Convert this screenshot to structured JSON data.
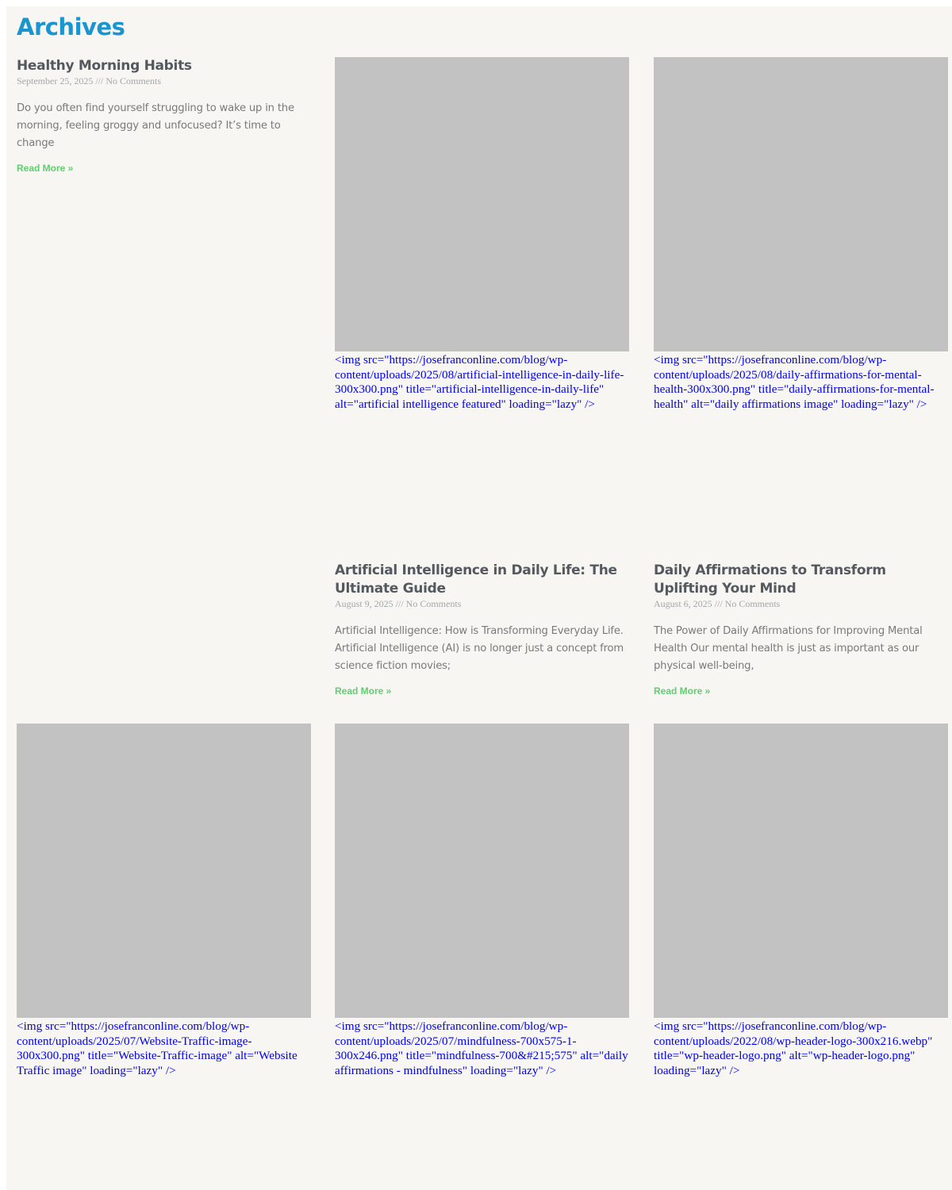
{
  "page": {
    "title": "Archives"
  },
  "colors": {
    "title": "#1a95cf",
    "read_more": "#61ce70",
    "post_title": "#54595f",
    "meta": "#a3a6aa",
    "thumbnail_placeholder": "#c2c2c2",
    "background": "#f7f6f3",
    "img_fallback_text": "#0000ee"
  },
  "posts": [
    {
      "title": "Healthy Morning Habits",
      "meta": "September 25, 2025 /// No Comments",
      "excerpt": "Do you often find yourself struggling to wake up in the morning, feeling groggy and unfocused? It’s time to change",
      "read_more": "Read More »"
    },
    {
      "img_text": "<img src=\"https://josefranconline.com/blog/wp-content/uploads/2025/08/artificial-intelligence-in-daily-life-300x300.png\" title=\"artificial-intelligence-in-daily-life\" alt=\"artificial intelligence featured\" loading=\"lazy\" />",
      "title": "Artificial Intelligence in Daily Life: The Ultimate Guide",
      "meta": "August 9, 2025 /// No Comments",
      "excerpt": "Artificial Intelligence: How is Transforming Everyday Life. Artificial Intelligence (AI) is no longer just a concept from science fiction movies;",
      "read_more": "Read More »"
    },
    {
      "img_text": "<img src=\"https://josefranconline.com/blog/wp-content/uploads/2025/08/daily-affirmations-for-mental-health-300x300.png\" title=\"daily-affirmations-for-mental-health\" alt=\"daily affirmations image\" loading=\"lazy\" />",
      "title": "Daily Affirmations to Transform Uplifting Your Mind",
      "meta": "August 6, 2025 /// No Comments",
      "excerpt": "The Power of Daily Affirmations for Improving Mental Health Our mental health is just as important as our physical well-being,",
      "read_more": "Read More »"
    },
    {
      "img_text": "<img src=\"https://josefranconline.com/blog/wp-content/uploads/2025/07/Website-Traffic-image-300x300.png\" title=\"Website-Traffic-image\" alt=\"Website Traffic image\" loading=\"lazy\" />"
    },
    {
      "img_text": "<img src=\"https://josefranconline.com/blog/wp-content/uploads/2025/07/mindfulness-700x575-1-300x246.png\" title=\"mindfulness-700&#215;575\" alt=\"daily affirmations - mindfulness\" loading=\"lazy\" />"
    },
    {
      "img_text": "<img src=\"https://josefranconline.com/blog/wp-content/uploads/2022/08/wp-header-logo-300x216.webp\" title=\"wp-header-logo.png\" alt=\"wp-header-logo.png\" loading=\"lazy\" />"
    }
  ]
}
